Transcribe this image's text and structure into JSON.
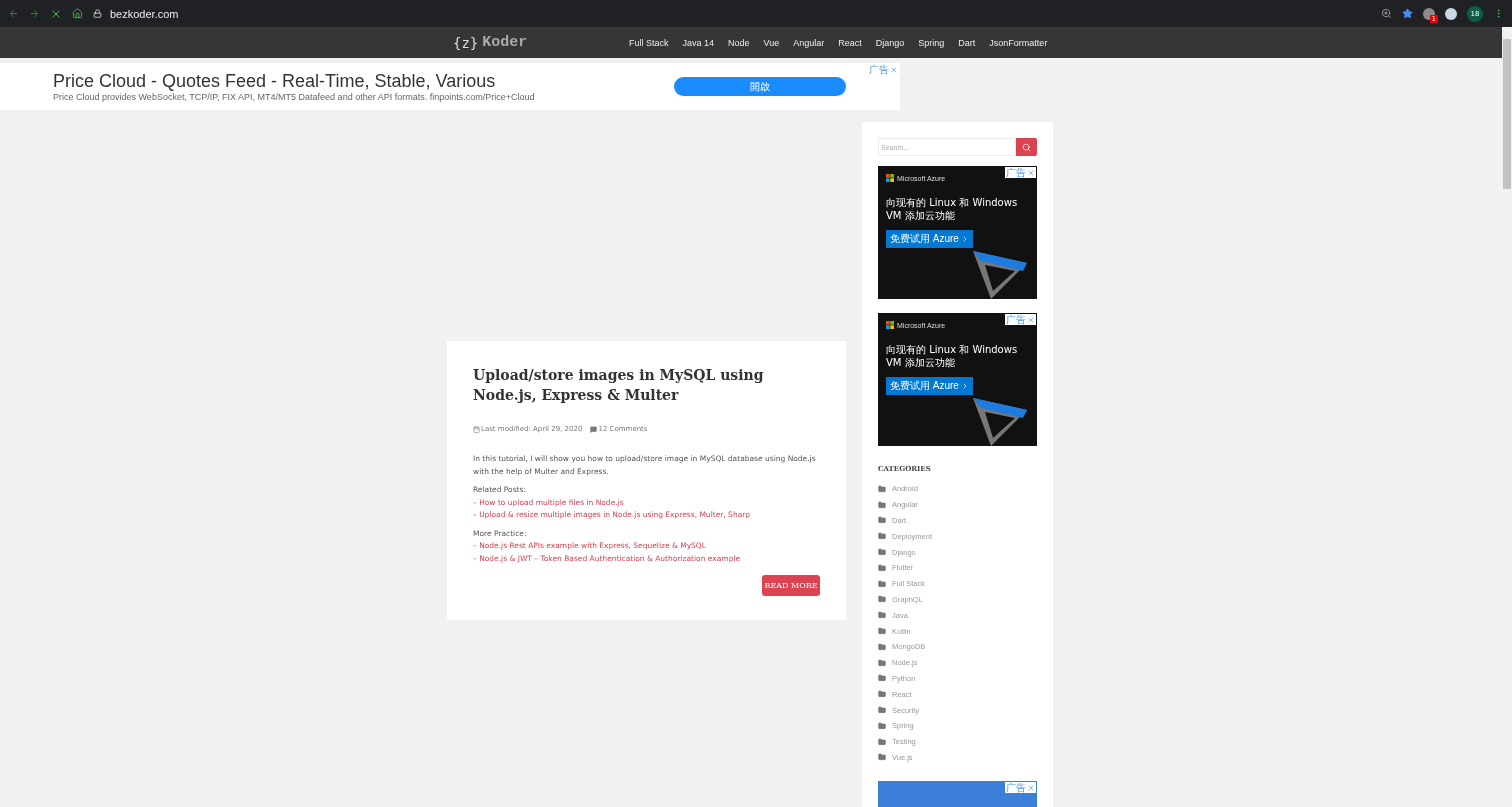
{
  "browser": {
    "url": "bezkoder.com",
    "loading": true,
    "extension_badge": "1",
    "profile_initials": "18"
  },
  "site_nav": {
    "logo_brace": "{z}",
    "logo_word": "Koder",
    "links": [
      "Full Stack",
      "Java 14",
      "Node",
      "Vue",
      "Angular",
      "React",
      "Django",
      "Spring",
      "Dart",
      "JsonFormatter"
    ]
  },
  "top_ad": {
    "title": "Price Cloud - Quotes Feed - Real-Time, Stable, Various",
    "description": "Price Cloud provides WebSocket, TCP/IP, FIX API, MT4/MT5 Datafeed and other API formats. finpoints.com/Price+Cloud",
    "button": "開啟",
    "ad_label": "广告"
  },
  "post": {
    "title": "Upload/store images in MySQL using Node.js, Express & Multer",
    "modified": "Last modified: April 29, 2020",
    "comments": "12 Comments",
    "intro": "In this tutorial, I will show you how to upload/store image in MySQL database using Node.js with the help of Multer and Express.",
    "sections": [
      {
        "heading": "Related Posts:",
        "links": [
          "– How to upload multiple files in Node.js",
          "– Upload & resize multiple images in Node.js using Express, Multer, Sharp"
        ]
      },
      {
        "heading": "More Practice:",
        "links": [
          "– Node.js Rest APIs example with Express, Sequelize & MySQL",
          "– Node.js & JWT – Token Based Authentication & Authorization example"
        ]
      }
    ],
    "read_more": "READ MORE"
  },
  "sidebar": {
    "search": {
      "placeholder": "Search..."
    },
    "ads": [
      {
        "brand": "Microsoft Azure",
        "headline": "向现有的 Linux 和 Windows VM 添加云功能",
        "button": "免费试用 Azure",
        "ad_label": "广告"
      },
      {
        "brand": "Microsoft Azure",
        "headline": "向现有的 Linux 和 Windows VM 添加云功能",
        "button": "免费试用 Azure",
        "ad_label": "广告"
      }
    ],
    "categories_title": "CATEGORIES",
    "categories": [
      "Android",
      "Angular",
      "Dart",
      "Deployment",
      "Django",
      "Flutter",
      "Full Stack",
      "GraphQL",
      "Java",
      "Kotlin",
      "MongoDB",
      "Node.js",
      "Python",
      "React",
      "Security",
      "Spring",
      "Testing",
      "Vue.js"
    ],
    "bottom_ad": {
      "ad_label": "广告"
    }
  }
}
